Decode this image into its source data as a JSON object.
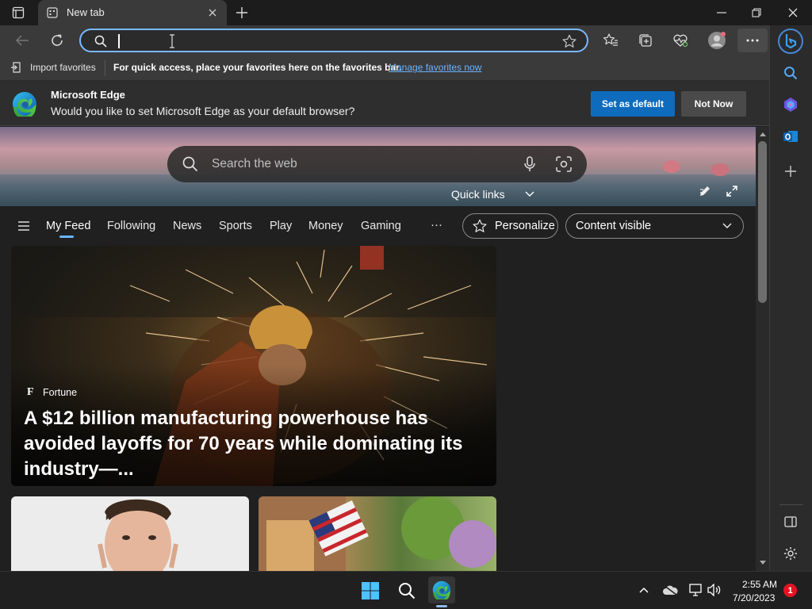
{
  "tab": {
    "title": "New tab"
  },
  "window": {
    "minimize": "─",
    "restore": "❐",
    "close": "✕"
  },
  "toolbar": {
    "address_value": ""
  },
  "favorites_bar": {
    "import_label": "Import favorites",
    "hint": "For quick access, place your favorites here on the favorites bar.",
    "manage_link": "Manage favorites now"
  },
  "infobar": {
    "title": "Microsoft Edge",
    "message": "Would you like to set Microsoft Edge as your default browser?",
    "set_default": "Set as default",
    "not_now": "Not Now"
  },
  "newtab": {
    "search_placeholder": "Search the web",
    "quick_links": "Quick links"
  },
  "feed_nav": {
    "items": [
      "My Feed",
      "Following",
      "News",
      "Sports",
      "Play",
      "Money",
      "Gaming"
    ],
    "more": "···",
    "personalize": "Personalize",
    "content_visible": "Content visible"
  },
  "cards": {
    "main": {
      "source": "Fortune",
      "source_letter": "F",
      "headline": "A $12 billion manufacturing powerhouse has avoided layoffs for 70 years while dominating its industry—..."
    }
  },
  "taskbar": {
    "time": "2:55 AM",
    "date": "7/20/2023",
    "notification_count": "1"
  },
  "colors": {
    "accent": "#0f6cbd",
    "address_border": "#7cb8ff",
    "link": "#6cb4ff",
    "notification": "#e81123"
  }
}
